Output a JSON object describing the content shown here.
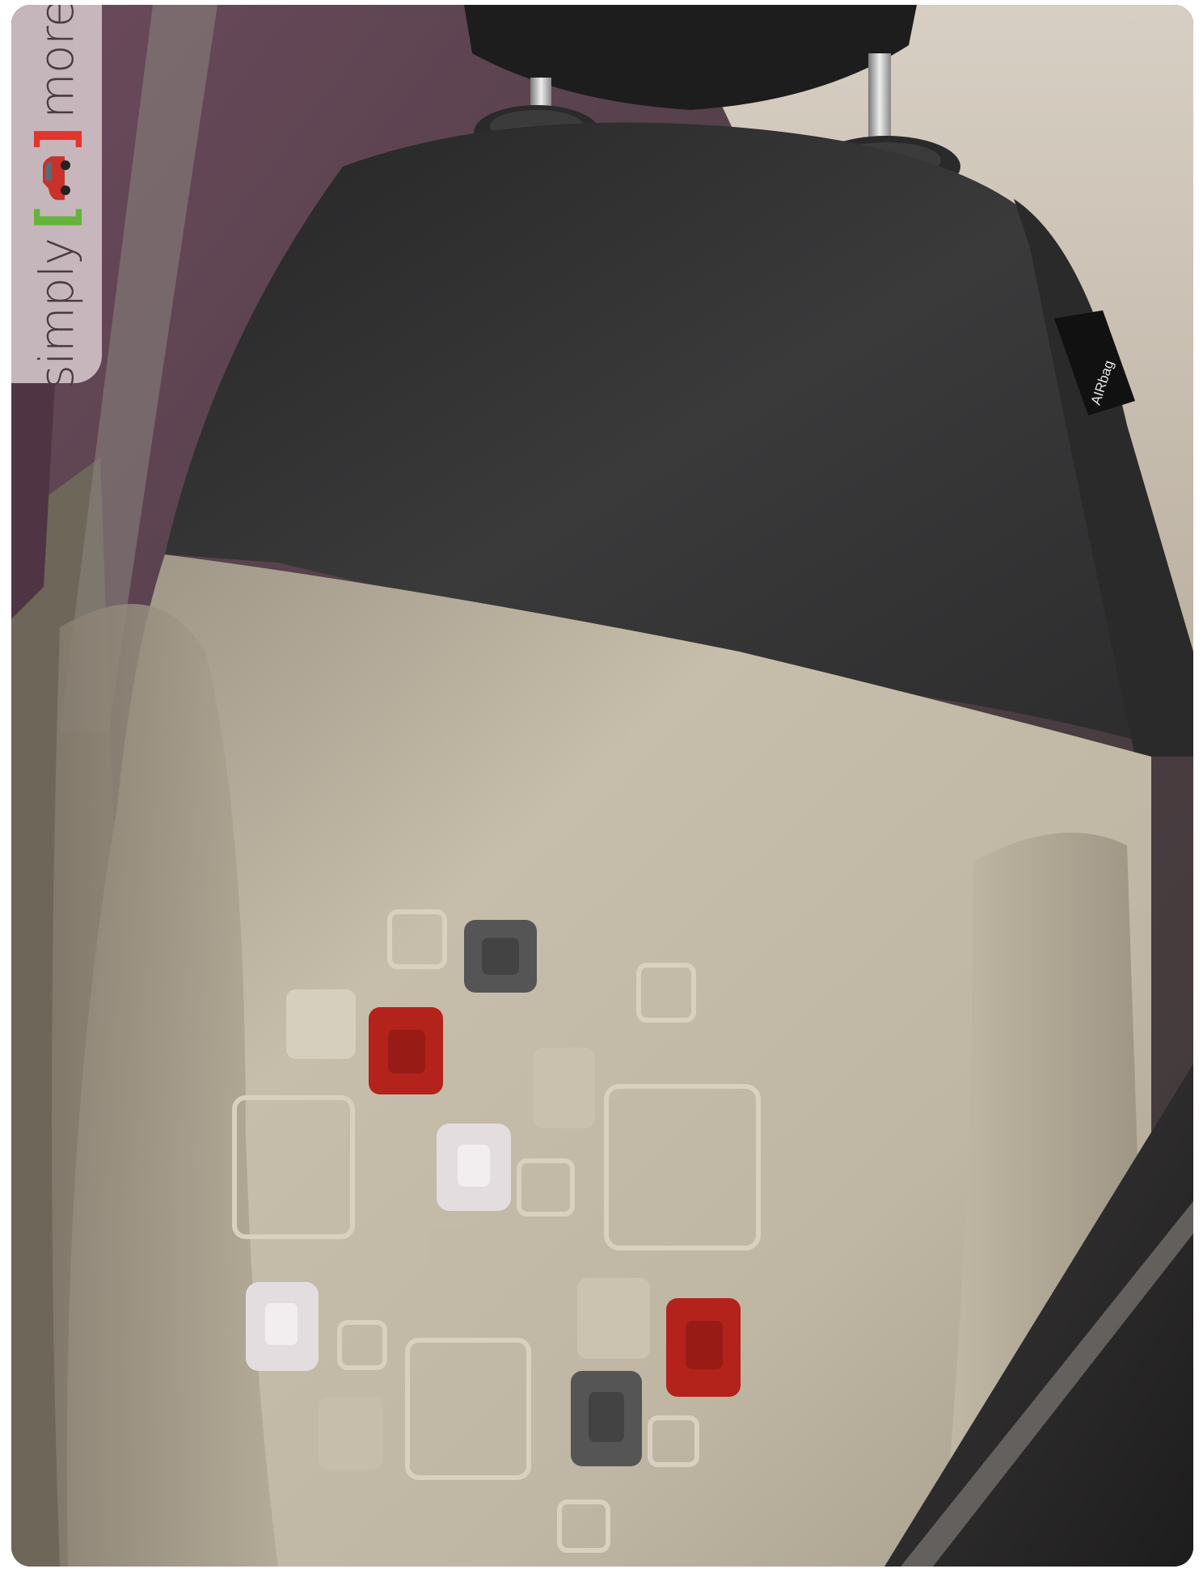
{
  "brand_tag": {
    "word_before": "simply",
    "word_after": "more",
    "bracket_left": "[",
    "bracket_right": "]",
    "icon": "car-icon"
  },
  "seat_label": {
    "text": "AIRbag"
  },
  "colors": {
    "bracket_left": "#64b33a",
    "bracket_right": "#e0362c",
    "seat_fabric": "#bdb3a0",
    "seat_upper": "#333334",
    "interior_trim": "#5b3f4d"
  }
}
